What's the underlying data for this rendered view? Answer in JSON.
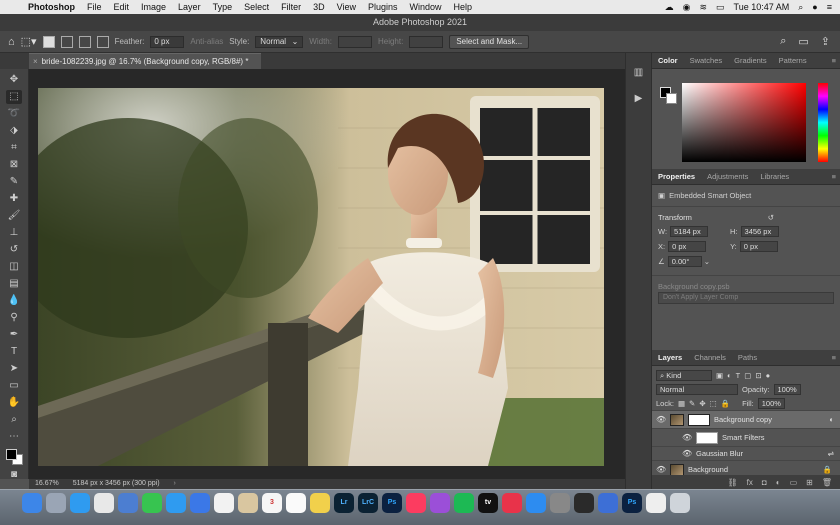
{
  "menubar": {
    "app_name": "Photoshop",
    "items": [
      "File",
      "Edit",
      "Image",
      "Layer",
      "Type",
      "Select",
      "Filter",
      "3D",
      "View",
      "Plugins",
      "Window",
      "Help"
    ],
    "clock": "Tue 10:47 AM"
  },
  "window": {
    "title": "Adobe Photoshop 2021"
  },
  "options": {
    "feather_label": "Feather:",
    "feather_value": "0 px",
    "antialias_label": "Anti-alias",
    "style_label": "Style:",
    "style_value": "Normal",
    "width_label": "Width:",
    "height_label": "Height:",
    "select_mask_button": "Select and Mask..."
  },
  "document": {
    "tab_title": "bride-1082239.jpg @ 16.7% (Background copy, RGB/8#) *",
    "zoom": "16.67%",
    "info": "5184 px x 3456 px (300 ppi)"
  },
  "color_panel": {
    "tabs": [
      "Color",
      "Swatches",
      "Gradients",
      "Patterns"
    ],
    "active_tab": "Color",
    "foreground": "#000000",
    "background": "#ffffff"
  },
  "properties": {
    "tabs": [
      "Properties",
      "Adjustments",
      "Libraries"
    ],
    "object_type": "Embedded Smart Object",
    "transform_title": "Transform",
    "w_label": "W:",
    "w_value": "5184 px",
    "h_label": "H:",
    "h_value": "3456 px",
    "x_label": "X:",
    "x_value": "0 px",
    "y_label": "Y:",
    "y_value": "0 px",
    "angle_value": "0.00°",
    "source_file": "Background copy.psb",
    "comp_dropdown": "Don't Apply Layer Comp"
  },
  "layers_panel": {
    "tabs": [
      "Layers",
      "Channels",
      "Paths"
    ],
    "filter_kind": "Kind",
    "blend_mode": "Normal",
    "opacity_label": "Opacity:",
    "opacity_value": "100%",
    "lock_label": "Lock:",
    "fill_label": "Fill:",
    "fill_value": "100%",
    "layers": [
      {
        "name": "Background copy",
        "selected": true
      },
      {
        "name": "Smart Filters",
        "selected": false
      },
      {
        "name": "Gaussian Blur",
        "selected": false
      },
      {
        "name": "Background",
        "selected": false
      }
    ],
    "footer_fx": "fx"
  },
  "dock": {
    "apps": [
      {
        "label": "",
        "color": "#3d86e8"
      },
      {
        "label": "",
        "color": "#9aa5b5"
      },
      {
        "label": "",
        "color": "#2f9bf0"
      },
      {
        "label": "",
        "color": "#e8e8e8"
      },
      {
        "label": "",
        "color": "#4c7ed1"
      },
      {
        "label": "",
        "color": "#37c450"
      },
      {
        "label": "",
        "color": "#2f9bf0"
      },
      {
        "label": "",
        "color": "#3b78e7"
      },
      {
        "label": "",
        "color": "#f2f2f2"
      },
      {
        "label": "",
        "color": "#d9c6a0"
      },
      {
        "label": "3",
        "color": "#f6f6f6"
      },
      {
        "label": "",
        "color": "#fafafa"
      },
      {
        "label": "",
        "color": "#f1d04b"
      },
      {
        "label": "Lr",
        "color": "#0b2233"
      },
      {
        "label": "LrC",
        "color": "#0b2233"
      },
      {
        "label": "Ps",
        "color": "#0b2140"
      },
      {
        "label": "",
        "color": "#fc3c60"
      },
      {
        "label": "",
        "color": "#9b4fd8"
      },
      {
        "label": "",
        "color": "#1db954"
      },
      {
        "label": "tv",
        "color": "#111111"
      },
      {
        "label": "",
        "color": "#e8334a"
      },
      {
        "label": "",
        "color": "#2d8cf0"
      },
      {
        "label": "",
        "color": "#888888"
      },
      {
        "label": "",
        "color": "#2a2a2a"
      },
      {
        "label": "",
        "color": "#3d6fd6"
      },
      {
        "label": "Ps",
        "color": "#0b2140"
      },
      {
        "label": "",
        "color": "#eeeeee"
      },
      {
        "label": "",
        "color": "#cfd4da"
      }
    ]
  }
}
